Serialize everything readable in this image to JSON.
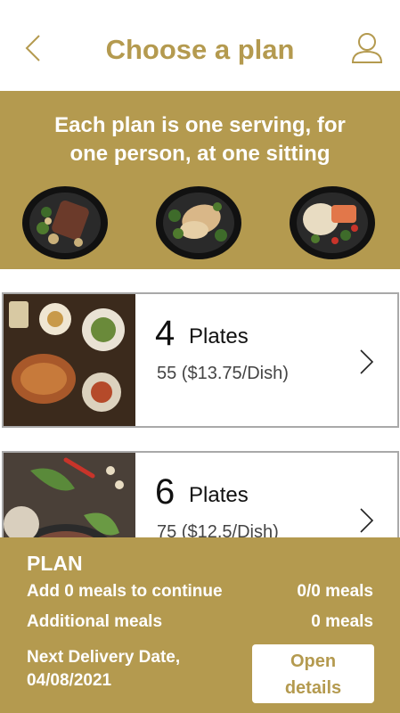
{
  "header": {
    "title": "Choose a plan",
    "back_icon": "chevron-left-icon",
    "profile_icon": "user-icon"
  },
  "banner": {
    "line1": "Each plan is one serving, for",
    "line2": "one person, at one sitting",
    "plates": [
      "steak-plate",
      "chicken-plate",
      "salmon-rice-plate"
    ]
  },
  "plans": [
    {
      "count": "4",
      "label": "Plates",
      "price": "55 ($13.75/Dish)"
    },
    {
      "count": "6",
      "label": "Plates",
      "price": "75 ($12.5/Dish)"
    }
  ],
  "footer": {
    "heading": "PLAN",
    "add_meals_label": "Add 0 meals to continue",
    "add_meals_value": "0/0 meals",
    "additional_label": "Additional meals",
    "additional_value": "0 meals",
    "next_delivery_line1": "Next Delivery Date,",
    "next_delivery_line2": "04/08/2021",
    "open_line1": "Open",
    "open_line2": "details"
  },
  "colors": {
    "accent": "#b49a4f",
    "card_border": "#a9a9a9"
  }
}
